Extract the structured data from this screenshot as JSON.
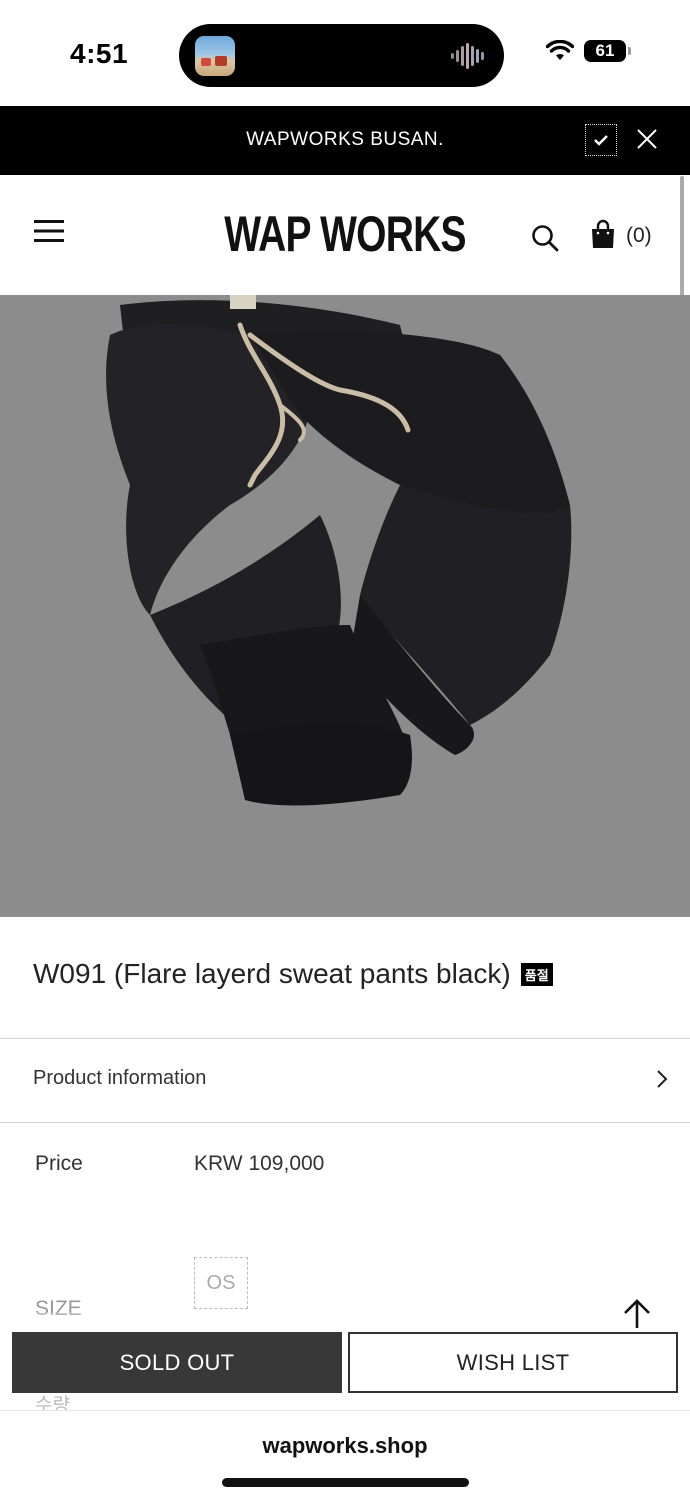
{
  "status_bar": {
    "time": "4:51",
    "battery": "61",
    "icons": [
      "wifi-icon",
      "battery-icon",
      "audio-wave-icon"
    ]
  },
  "announcement": {
    "text": "WAPWORKS BUSAN.",
    "icons": [
      "check-icon",
      "close-icon"
    ]
  },
  "header": {
    "logo": "WAP WORKS",
    "cart_count": "(0)",
    "icons": [
      "menu-icon",
      "search-icon",
      "cart-icon"
    ]
  },
  "product": {
    "title": "W091 (Flare layerd sweat pants black)",
    "badge": "품절",
    "info_label": "Product information",
    "price_label": "Price",
    "price_value": "KRW 109,000",
    "size_label": "SIZE",
    "size_option": "OS",
    "quantity_label": "수량"
  },
  "actions": {
    "sold_out": "SOLD OUT",
    "wish_list": "WISH LIST"
  },
  "browser": {
    "url": "wapworks.shop"
  },
  "colors": {
    "announcement_bg": "#000000",
    "image_bg": "#8c8c8c",
    "sold_out_bg": "#383838"
  }
}
